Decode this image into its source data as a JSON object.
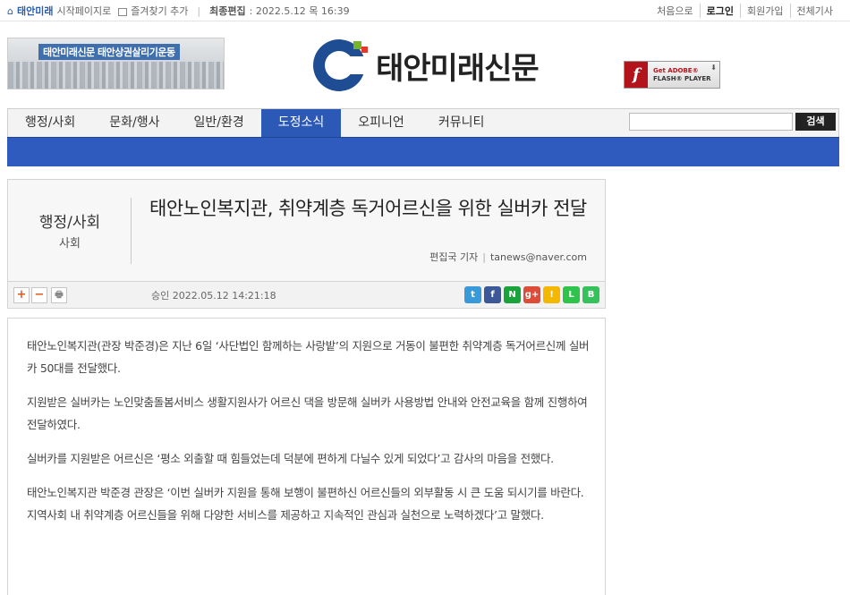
{
  "topbar": {
    "brand": "태안미래",
    "set_home": "시작페이지로",
    "bookmark": "즐겨찾기 추가",
    "last_edit_label": "최종편집",
    "last_edit_value": ": 2022.5.12 목 16:39",
    "links": [
      "처음으로",
      "로그인",
      "회원가입",
      "전체기사"
    ]
  },
  "banner": {
    "title": "태안미래신문 태안상권살리기운동"
  },
  "logo": {
    "text": "태안미래신문"
  },
  "flash": {
    "line1": "Get ADOBE®",
    "line2": "FLASH® PLAYER"
  },
  "nav": {
    "items": [
      "행정/사회",
      "문화/행사",
      "일반/환경",
      "도정소식",
      "오피니언",
      "커뮤니티"
    ],
    "active_index": 3,
    "search_button": "검색"
  },
  "article": {
    "category": "행정/사회",
    "subcategory": "사회",
    "title": "태안노인복지관, 취약계층 독거어르신을 위한 실버카 전달",
    "author": "편집국 기자",
    "email": "tanews@naver.com",
    "approved": "승인 2022.05.12  14:21:18",
    "paragraphs": [
      "태안노인복지관(관장 박준경)은 지난 6일 ‘사단법인 함께하는 사랑밭’의 지원으로 거동이 불편한 취약계층 독거어르신께 실버카 50대를 전달했다.",
      "지원받은 실버카는 노인맞춤돌봄서비스 생활지원사가 어르신 댁을 방문해 실버카 사용방법 안내와 안전교육을 함께 진행하여 전달하였다.",
      "실버카를 지원받은 어르신은 ‘평소 외출할 때 힘들었는데 덕분에 편하게 다닐수 있게 되었다’고 감사의 마음을 전했다.",
      "태안노인복지관 박준경 관장은 ‘이번 실버카 지원을 통해 보행이 불편하신 어르신들의 외부활동 시 큰 도움 되시기를 바란다. 지역사회 내 취약계층 어르신들을 위해 다양한 서비스를 제공하고 지속적인 관심과 실천으로 노력하겠다’고 말했다."
    ]
  },
  "tools": {
    "plus": "+",
    "minus": "−",
    "print": "🖶"
  },
  "share": [
    {
      "icon": "twitter-icon",
      "glyph": "t",
      "color": "#3a9ad9"
    },
    {
      "icon": "facebook-icon",
      "glyph": "f",
      "color": "#3b5998"
    },
    {
      "icon": "naver-icon",
      "glyph": "N",
      "color": "#19a33a"
    },
    {
      "icon": "google-plus-icon",
      "glyph": "g+",
      "color": "#dd4b39"
    },
    {
      "icon": "kakaostory-icon",
      "glyph": "!",
      "color": "#f5b800"
    },
    {
      "icon": "line-icon",
      "glyph": "L",
      "color": "#2ec44b"
    },
    {
      "icon": "band-icon",
      "glyph": "B",
      "color": "#35c25a"
    }
  ]
}
